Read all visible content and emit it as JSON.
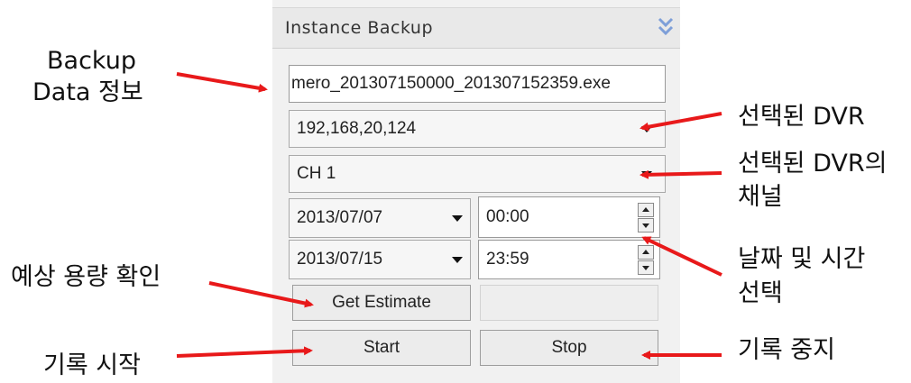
{
  "panel": {
    "title": "Instance Backup",
    "collapse_icon": "double-chevron-down-icon",
    "backup_file": "mero_201307150000_201307152359.exe",
    "dvr_select": "192,168,20,124",
    "channel_select": "CH 1",
    "start_date": "2013/07/07",
    "start_time": "00:00",
    "end_date": "2013/07/15",
    "end_time": "23:59",
    "estimate_button": "Get Estimate",
    "estimate_result": "",
    "start_button": "Start",
    "stop_button": "Stop"
  },
  "annotations": {
    "backup_info_line1": "Backup",
    "backup_info_line2": "Data 정보",
    "selected_dvr": "선택된 DVR",
    "selected_channel_line1": "선택된 DVR의",
    "selected_channel_line2": "채널",
    "datetime_line1": "날짜 및 시간",
    "datetime_line2": "선택",
    "estimate": "예상 용량 확인",
    "record_start": "기록 시작",
    "record_stop": "기록 중지"
  },
  "colors": {
    "arrow": "#e8191a",
    "panel_bg": "#f1f1f1",
    "chevron": "#6d8fcf"
  }
}
